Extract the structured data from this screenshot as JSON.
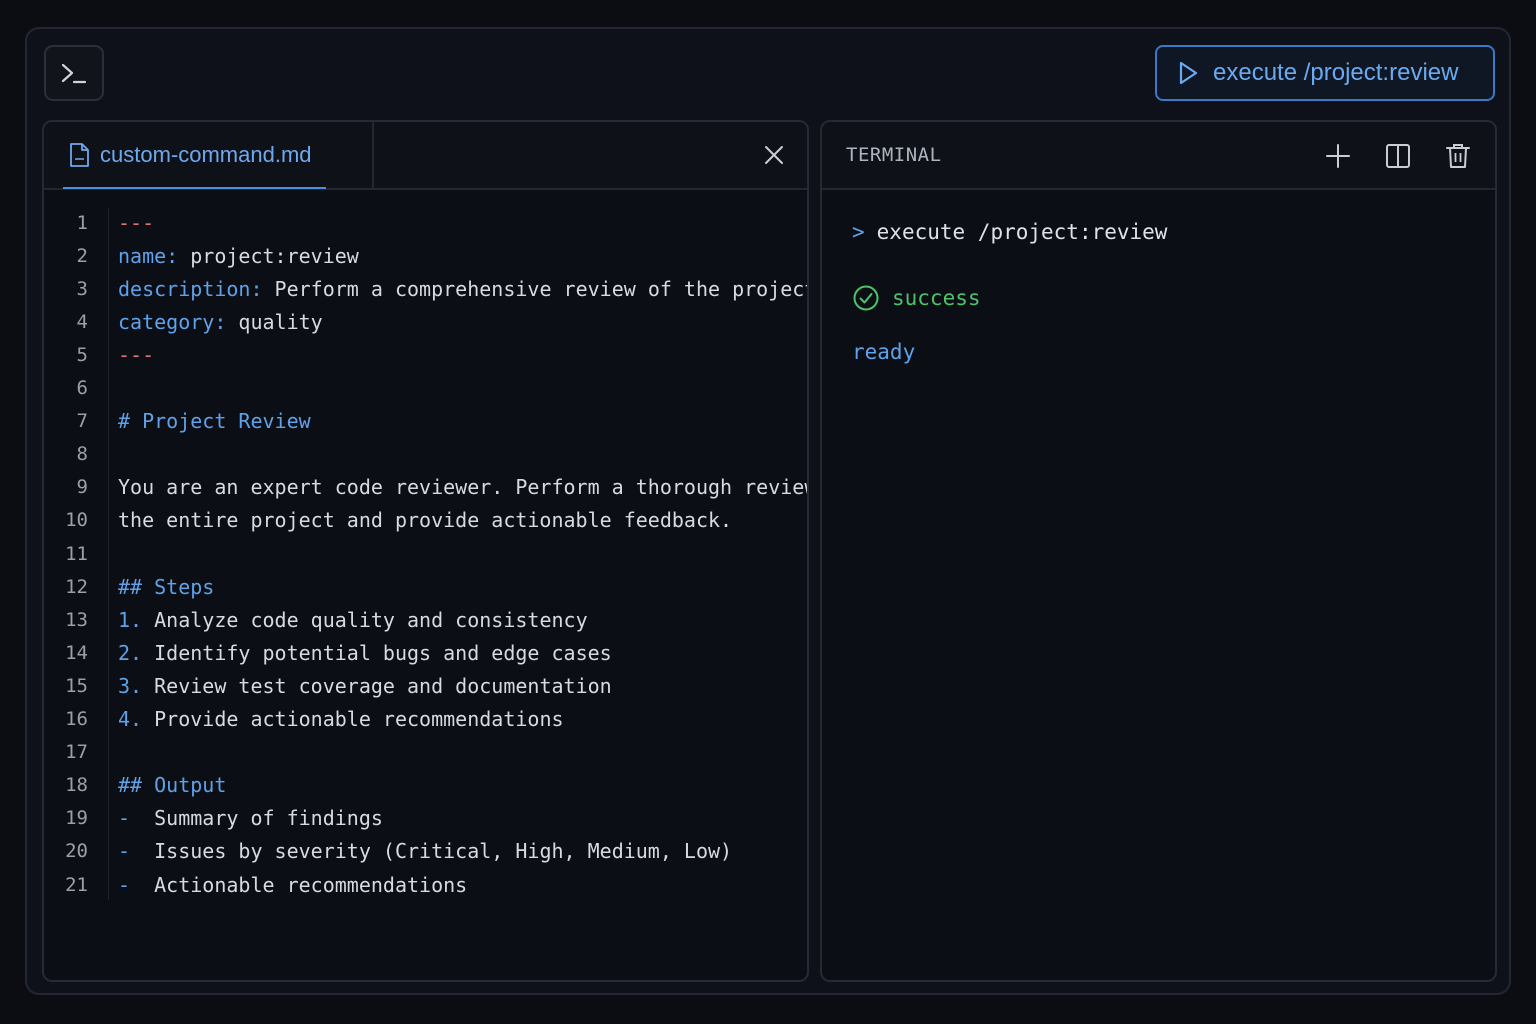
{
  "toolbar": {
    "terminal_icon": "terminal-prompt-icon",
    "execute_label": "execute /project:review",
    "execute_icon": "play-icon",
    "accent": "#3a78c8"
  },
  "editor": {
    "tab": {
      "label": "custom-command.md",
      "icon": "file-icon"
    },
    "close_icon": "close-icon",
    "lines": [
      {
        "n": "1",
        "parts": [
          {
            "t": "---",
            "c": "dash"
          }
        ]
      },
      {
        "n": "2",
        "parts": [
          {
            "t": "name:",
            "c": "key"
          },
          {
            "t": " project:review",
            "c": ""
          }
        ]
      },
      {
        "n": "3",
        "parts": [
          {
            "t": "description:",
            "c": "key"
          },
          {
            "t": " Perform a comprehensive review of the project",
            "c": ""
          }
        ]
      },
      {
        "n": "4",
        "parts": [
          {
            "t": "category:",
            "c": "key"
          },
          {
            "t": " quality",
            "c": ""
          }
        ]
      },
      {
        "n": "5",
        "parts": [
          {
            "t": "---",
            "c": "dash"
          }
        ]
      },
      {
        "n": "6",
        "parts": []
      },
      {
        "n": "7",
        "parts": [
          {
            "t": "# Project Review",
            "c": "head"
          }
        ]
      },
      {
        "n": "8",
        "parts": []
      },
      {
        "n": "9",
        "parts": [
          {
            "t": "You are an expert code reviewer. Perform a thorough review of",
            "c": ""
          }
        ]
      },
      {
        "n": "10",
        "parts": [
          {
            "t": "the entire project and provide actionable feedback.",
            "c": ""
          }
        ]
      },
      {
        "n": "11",
        "parts": []
      },
      {
        "n": "12",
        "parts": [
          {
            "t": "## Steps",
            "c": "head"
          }
        ]
      },
      {
        "n": "13",
        "parts": [
          {
            "t": "1.",
            "c": "num"
          },
          {
            "t": " Analyze code quality and consistency",
            "c": ""
          }
        ]
      },
      {
        "n": "14",
        "parts": [
          {
            "t": "2.",
            "c": "num"
          },
          {
            "t": " Identify potential bugs and edge cases",
            "c": ""
          }
        ]
      },
      {
        "n": "15",
        "parts": [
          {
            "t": "3.",
            "c": "num"
          },
          {
            "t": " Review test coverage and documentation",
            "c": ""
          }
        ]
      },
      {
        "n": "16",
        "parts": [
          {
            "t": "4.",
            "c": "num"
          },
          {
            "t": " Provide actionable recommendations",
            "c": ""
          }
        ]
      },
      {
        "n": "17",
        "parts": []
      },
      {
        "n": "18",
        "parts": [
          {
            "t": "## Output",
            "c": "head"
          }
        ]
      },
      {
        "n": "19",
        "parts": [
          {
            "t": "-",
            "c": "num"
          },
          {
            "t": "  Summary of findings",
            "c": ""
          }
        ]
      },
      {
        "n": "20",
        "parts": [
          {
            "t": "-",
            "c": "num"
          },
          {
            "t": "  Issues by severity (Critical, High, Medium, Low)",
            "c": ""
          }
        ]
      },
      {
        "n": "21",
        "parts": [
          {
            "t": "-",
            "c": "num"
          },
          {
            "t": "  Actionable recommendations",
            "c": ""
          }
        ]
      }
    ]
  },
  "terminal": {
    "title": "TERMINAL",
    "actions": [
      {
        "name": "add-terminal-button",
        "icon": "plus-icon"
      },
      {
        "name": "split-terminal-button",
        "icon": "split-icon"
      },
      {
        "name": "delete-terminal-button",
        "icon": "trash-icon"
      }
    ],
    "prompt": ">",
    "command": "execute /project:review",
    "status": "success",
    "status_icon": "check-circle-icon",
    "ready": "ready"
  }
}
